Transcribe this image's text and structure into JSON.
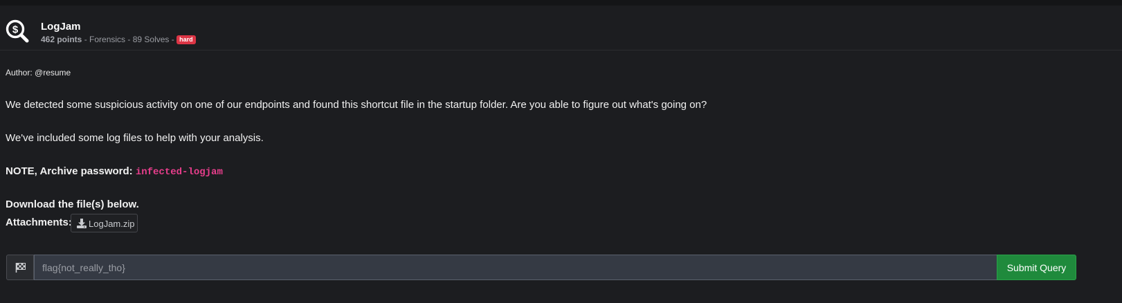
{
  "challenge": {
    "title": "LogJam",
    "points": "462 points",
    "separator1": " - ",
    "category": "Forensics",
    "separator2": " - ",
    "solves": "89 Solves",
    "separator3": " - ",
    "difficulty": "hard",
    "difficulty_color": "#dc3545",
    "icon": "dollar-search-icon"
  },
  "description": {
    "author": "Author: @resume",
    "paragraph1": "We detected some suspicious activity on one of our endpoints and found this shortcut file in the startup folder. Are you able to figure out what's going on?",
    "paragraph2": "We've included some log files to help with your analysis.",
    "note_prefix": "NOTE, Archive password: ",
    "note_password": "infected-logjam",
    "download_text": "Download the file(s) below."
  },
  "attachments": {
    "label": "Attachments:",
    "files": [
      {
        "name": "LogJam.zip",
        "icon": "download-icon"
      }
    ]
  },
  "submission": {
    "addon_icon": "checkered-flag-icon",
    "placeholder": "flag{not_really_tho}",
    "value": "",
    "submit_label": "Submit Query",
    "submit_color": "#1f8a3c"
  },
  "colors": {
    "background": "#1c1d20",
    "code_pink": "#e83e8c"
  }
}
